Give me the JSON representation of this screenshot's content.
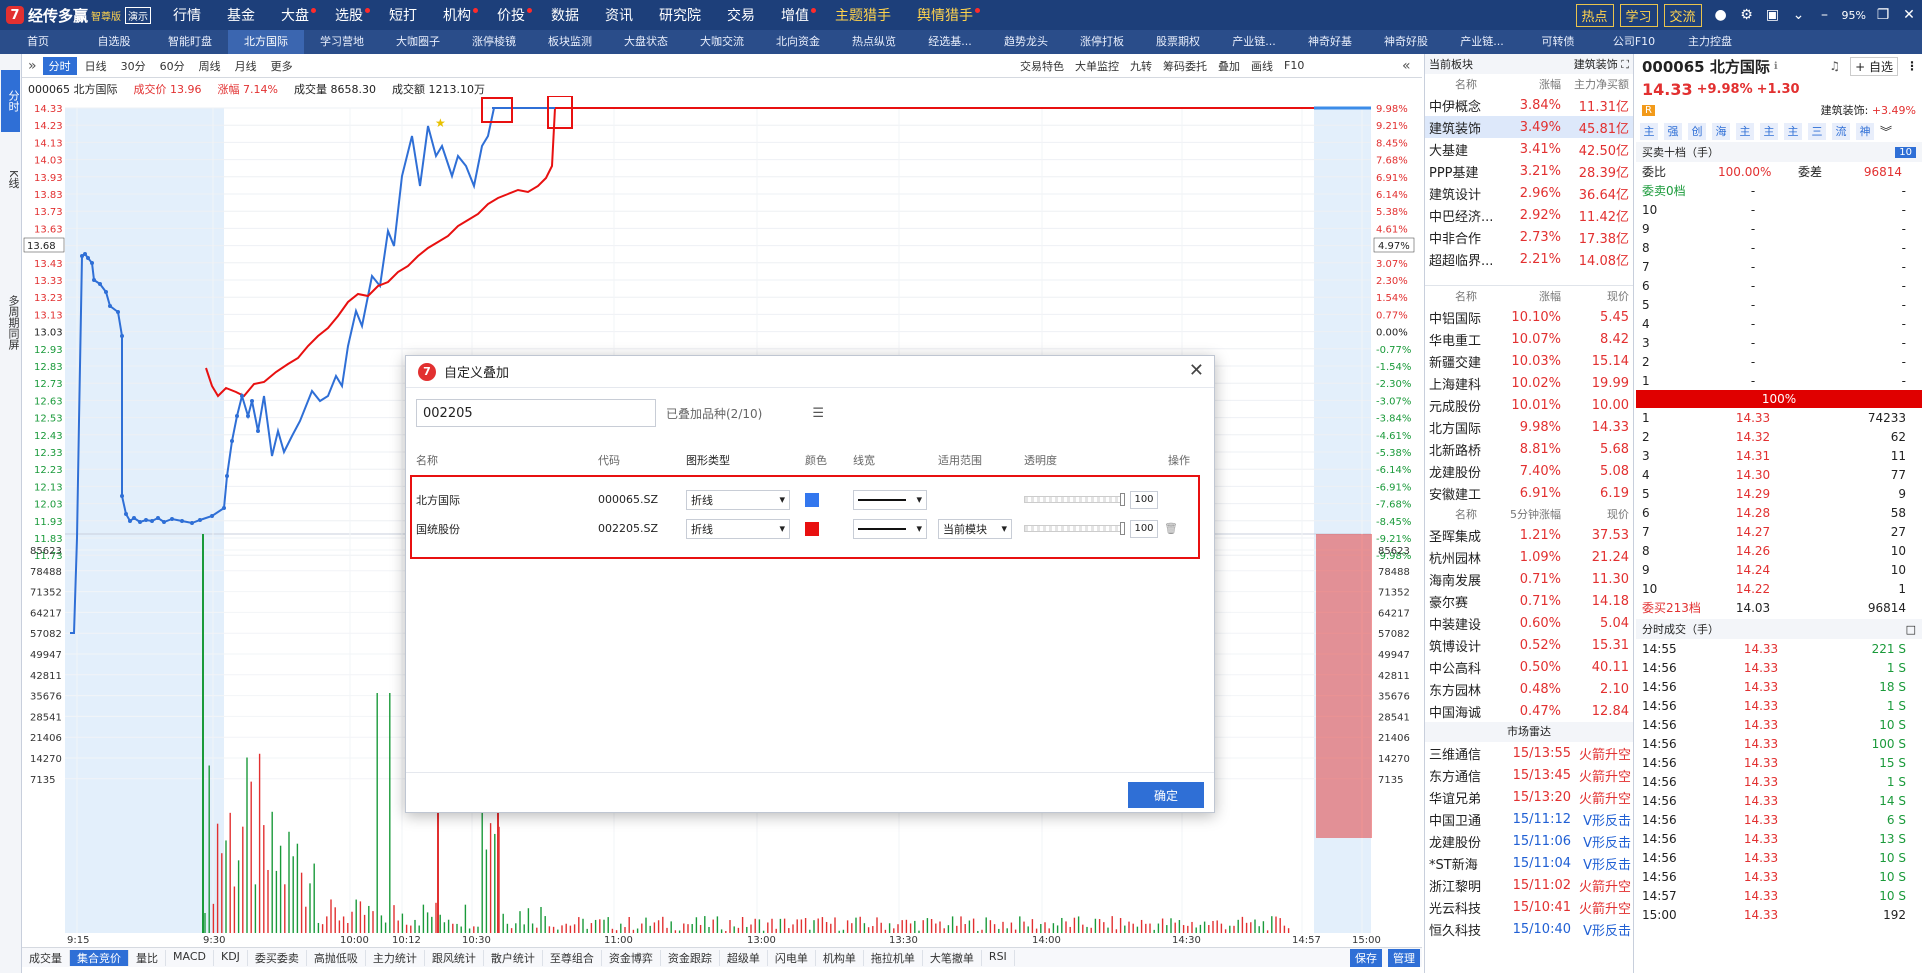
{
  "app": {
    "name": "经传多赢",
    "edition": "智尊版",
    "mode": "演示"
  },
  "menu": [
    {
      "label": "行情",
      "dot": false,
      "hl": false
    },
    {
      "label": "基金",
      "dot": false,
      "hl": false
    },
    {
      "label": "大盘",
      "dot": true,
      "hl": false
    },
    {
      "label": "选股",
      "dot": true,
      "hl": false
    },
    {
      "label": "短打",
      "dot": false,
      "hl": false
    },
    {
      "label": "机构",
      "dot": true,
      "hl": false
    },
    {
      "label": "价投",
      "dot": true,
      "hl": false
    },
    {
      "label": "数据",
      "dot": false,
      "hl": false
    },
    {
      "label": "资讯",
      "dot": false,
      "hl": false
    },
    {
      "label": "研究院",
      "dot": false,
      "hl": false
    },
    {
      "label": "交易",
      "dot": false,
      "hl": false
    },
    {
      "label": "增值",
      "dot": true,
      "hl": false
    },
    {
      "label": "主题猎手",
      "dot": false,
      "hl": true
    },
    {
      "label": "舆情猎手",
      "dot": true,
      "hl": true
    }
  ],
  "top_right": {
    "hot": "热点",
    "learn": "学习",
    "chat": "交流",
    "zoom": "95%"
  },
  "tabs": [
    "首页",
    "自选股",
    "智能盯盘",
    "北方国际",
    "学习营地",
    "大咖圈子",
    "涨停棱镜",
    "板块监测",
    "大盘状态",
    "大咖交流",
    "北向资金",
    "热点纵览",
    "经选基...",
    "趋势龙头",
    "涨停打板",
    "股票期权",
    "产业链...",
    "神奇好基",
    "神奇好股",
    "产业链...",
    "可转债",
    "公司F10",
    "主力控盘"
  ],
  "left_strip": {
    "intraday": "分时",
    "kline": "K线",
    "multi": "多周期同屏"
  },
  "chart_toolbar": {
    "periods": [
      "分时",
      "日线",
      "30分",
      "60分",
      "周线",
      "月线",
      "更多"
    ],
    "right": [
      "交易特色",
      "大单监控",
      "九转",
      "筹码委托",
      "叠加",
      "画线",
      "F10"
    ]
  },
  "info": {
    "stock": "000065 北方国际",
    "price_label": "成交价",
    "price": "13.96",
    "change_label": "涨幅",
    "change": "7.14%",
    "volume_label": "成交量",
    "volume": "8658.30",
    "amount_label": "成交额",
    "amount": "1213.10万"
  },
  "chart_labels": {
    "price_axis": [
      "14.33",
      "14.23",
      "14.13",
      "14.03",
      "13.93",
      "13.83",
      "13.73",
      "13.63",
      "13.53",
      "13.43",
      "13.33",
      "13.23",
      "13.13",
      "13.03",
      "12.93",
      "12.83",
      "12.73",
      "12.63",
      "12.53",
      "12.43",
      "12.33",
      "12.23",
      "12.13",
      "12.03",
      "11.93",
      "11.83",
      "11.73"
    ],
    "pct_axis": [
      "9.98%",
      "9.21%",
      "8.45%",
      "7.68%",
      "6.91%",
      "6.14%",
      "5.38%",
      "4.61%",
      "3.84%",
      "3.07%",
      "2.30%",
      "1.54%",
      "0.77%",
      "0.00%",
      "-0.77%",
      "-1.54%",
      "-2.30%",
      "-3.07%",
      "-3.84%",
      "-4.61%",
      "-5.38%",
      "-6.14%",
      "-6.91%",
      "-7.68%",
      "-8.45%",
      "-9.21%",
      "-9.98%"
    ],
    "cursor_price": "13.68",
    "cursor_pct": "4.97%",
    "vol_axis": [
      "85623",
      "78488",
      "71352",
      "64217",
      "57082",
      "49947",
      "42811",
      "35676",
      "28541",
      "21406",
      "14270",
      "7135"
    ],
    "time_axis": [
      "9:15",
      "9:30",
      "10:00",
      "10:12",
      "10:30",
      "11:00",
      "13:00",
      "13:30",
      "14:00",
      "14:30",
      "14:57",
      "15:00"
    ]
  },
  "bottom_tabs": [
    "成交量",
    "集合竞价",
    "量比",
    "MACD",
    "KDJ",
    "委买委卖",
    "高抛低吸",
    "主力统计",
    "跟风统计",
    "散户统计",
    "至尊组合",
    "资金博弈",
    "资金跟踪",
    "超级单",
    "闪电单",
    "机构单",
    "拖拉机单",
    "大笔撤单",
    "RSI"
  ],
  "bottom_right": [
    "保存",
    "管理"
  ],
  "dialog": {
    "title": "自定义叠加",
    "search_value": "002205",
    "count": "已叠加品种(2/10)",
    "headers": {
      "name": "名称",
      "code": "代码",
      "type": "图形类型",
      "color": "颜色",
      "width": "线宽",
      "scope": "适用范围",
      "opacity": "透明度",
      "op": "操作"
    },
    "rows": [
      {
        "name": "北方国际",
        "code": "000065.SZ",
        "type": "折线",
        "color": "#3377ee",
        "scope": "",
        "opacity": "100"
      },
      {
        "name": "国统股份",
        "code": "002205.SZ",
        "type": "折线",
        "color": "#e81010",
        "scope": "当前模块",
        "opacity": "100"
      }
    ],
    "ok": "确定"
  },
  "sector": {
    "header": "当前板块",
    "current": "建筑装饰",
    "cols1": [
      "名称",
      "涨幅",
      "主力净买额"
    ],
    "boards": [
      {
        "name": "中伊概念",
        "chg": "3.84%",
        "val": "11.31亿"
      },
      {
        "name": "建筑装饰",
        "chg": "3.49%",
        "val": "45.81亿"
      },
      {
        "name": "大基建",
        "chg": "3.41%",
        "val": "42.50亿"
      },
      {
        "name": "PPP基建",
        "chg": "3.21%",
        "val": "28.39亿"
      },
      {
        "name": "建筑设计",
        "chg": "2.96%",
        "val": "36.64亿"
      },
      {
        "name": "中巴经济...",
        "chg": "2.92%",
        "val": "11.42亿"
      },
      {
        "name": "中非合作",
        "chg": "2.73%",
        "val": "17.38亿"
      },
      {
        "name": "超超临界...",
        "chg": "2.21%",
        "val": "14.08亿"
      }
    ],
    "cols2": [
      "名称",
      "涨幅",
      "现价"
    ],
    "stocks": [
      {
        "name": "中铝国际",
        "chg": "10.10%",
        "val": "5.45"
      },
      {
        "name": "华电重工",
        "chg": "10.07%",
        "val": "8.42"
      },
      {
        "name": "新疆交建",
        "chg": "10.03%",
        "val": "15.14"
      },
      {
        "name": "上海建科",
        "chg": "10.02%",
        "val": "19.99"
      },
      {
        "name": "元成股份",
        "chg": "10.01%",
        "val": "10.00"
      },
      {
        "name": "北方国际",
        "chg": "9.98%",
        "val": "14.33"
      },
      {
        "name": "北新路桥",
        "chg": "8.81%",
        "val": "5.68"
      },
      {
        "name": "龙建股份",
        "chg": "7.40%",
        "val": "5.08"
      },
      {
        "name": "安徽建工",
        "chg": "6.91%",
        "val": "6.19"
      }
    ],
    "cols3": [
      "名称",
      "5分钟涨幅",
      "现价"
    ],
    "movers": [
      {
        "name": "圣晖集成",
        "chg": "1.21%",
        "val": "37.53"
      },
      {
        "name": "杭州园林",
        "chg": "1.09%",
        "val": "21.24"
      },
      {
        "name": "海南发展",
        "chg": "0.71%",
        "val": "11.30"
      },
      {
        "name": "豪尔赛",
        "chg": "0.71%",
        "val": "14.18"
      },
      {
        "name": "中装建设",
        "chg": "0.60%",
        "val": "5.04"
      },
      {
        "name": "筑博设计",
        "chg": "0.52%",
        "val": "15.31"
      },
      {
        "name": "中公高科",
        "chg": "0.50%",
        "val": "40.11"
      },
      {
        "name": "东方园林",
        "chg": "0.48%",
        "val": "2.10"
      },
      {
        "name": "中国海诚",
        "chg": "0.47%",
        "val": "12.84"
      }
    ],
    "radar_title": "市场雷达",
    "radar": [
      {
        "name": "三维通信",
        "time": "15/13:55",
        "sig": "火箭升空",
        "up": true
      },
      {
        "name": "东方通信",
        "time": "15/13:45",
        "sig": "火箭升空",
        "up": true
      },
      {
        "name": "华谊兄弟",
        "time": "15/13:20",
        "sig": "火箭升空",
        "up": true
      },
      {
        "name": "中国卫通",
        "time": "15/11:12",
        "sig": "V形反击",
        "up": false
      },
      {
        "name": "龙建股份",
        "time": "15/11:06",
        "sig": "V形反击",
        "up": false
      },
      {
        "name": "*ST新海",
        "time": "15/11:04",
        "sig": "V形反击",
        "up": false
      },
      {
        "name": "浙江黎明",
        "time": "15/11:02",
        "sig": "火箭升空",
        "up": true
      },
      {
        "name": "光云科技",
        "time": "15/10:41",
        "sig": "火箭升空",
        "up": true
      },
      {
        "name": "恒久科技",
        "time": "15/10:40",
        "sig": "V形反击",
        "up": false
      }
    ]
  },
  "quote": {
    "title": "000065 北方国际",
    "price": "14.33",
    "pct": "+9.98%",
    "chg": "+1.30",
    "fav": "自选",
    "sector_label": "建筑装饰:",
    "sector_pct": "+3.49%",
    "tags": [
      "主",
      "强",
      "创",
      "海",
      "主",
      "主",
      "主",
      "三",
      "流",
      "神"
    ],
    "book_title": "买卖十档（手）",
    "book_badge": "10",
    "ratio_label": "委比",
    "ratio": "100.00%",
    "diff_label": "委差",
    "diff": "96814",
    "sell_label": "委卖0档",
    "dash": "-",
    "sells": [
      "10",
      "9",
      "8",
      "7",
      "6",
      "5",
      "4",
      "3",
      "2",
      "1"
    ],
    "bar": "100%",
    "buys": [
      {
        "lvl": "1",
        "price": "14.33",
        "vol": "74233"
      },
      {
        "lvl": "2",
        "price": "14.32",
        "vol": "62"
      },
      {
        "lvl": "3",
        "price": "14.31",
        "vol": "11"
      },
      {
        "lvl": "4",
        "price": "14.30",
        "vol": "77"
      },
      {
        "lvl": "5",
        "price": "14.29",
        "vol": "9"
      },
      {
        "lvl": "6",
        "price": "14.28",
        "vol": "58"
      },
      {
        "lvl": "7",
        "price": "14.27",
        "vol": "27"
      },
      {
        "lvl": "8",
        "price": "14.26",
        "vol": "10"
      },
      {
        "lvl": "9",
        "price": "14.24",
        "vol": "10"
      },
      {
        "lvl": "10",
        "price": "14.22",
        "vol": "1"
      }
    ],
    "buy_total_label": "委买213档",
    "buy_total_price": "14.03",
    "buy_total_vol": "96814",
    "trades_title": "分时成交（手）",
    "trades": [
      {
        "t": "14:55",
        "p": "14.33",
        "v": "221 S"
      },
      {
        "t": "14:56",
        "p": "14.33",
        "v": "1 S"
      },
      {
        "t": "14:56",
        "p": "14.33",
        "v": "18 S"
      },
      {
        "t": "14:56",
        "p": "14.33",
        "v": "1 S"
      },
      {
        "t": "14:56",
        "p": "14.33",
        "v": "10 S"
      },
      {
        "t": "14:56",
        "p": "14.33",
        "v": "100 S"
      },
      {
        "t": "14:56",
        "p": "14.33",
        "v": "15 S"
      },
      {
        "t": "14:56",
        "p": "14.33",
        "v": "1 S"
      },
      {
        "t": "14:56",
        "p": "14.33",
        "v": "14 S"
      },
      {
        "t": "14:56",
        "p": "14.33",
        "v": "6 S"
      },
      {
        "t": "14:56",
        "p": "14.33",
        "v": "13 S"
      },
      {
        "t": "14:56",
        "p": "14.33",
        "v": "10 S"
      },
      {
        "t": "14:56",
        "p": "14.33",
        "v": "10 S"
      },
      {
        "t": "14:57",
        "p": "14.33",
        "v": "10 S"
      },
      {
        "t": "15:00",
        "p": "14.33",
        "v": "192"
      }
    ]
  },
  "colors": {
    "up": "#e23030",
    "down": "#1a9a3a",
    "accent": "#2f6fd6",
    "nav": "#1d3f7a"
  }
}
